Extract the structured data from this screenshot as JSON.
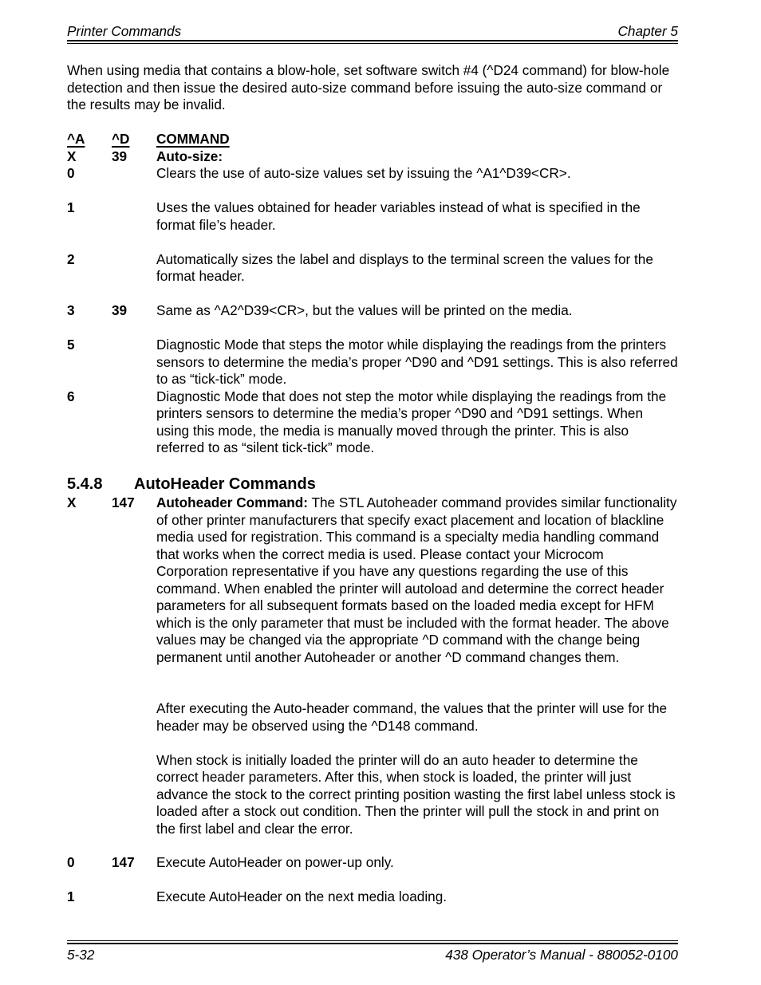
{
  "header": {
    "left": "Printer Commands",
    "right": "Chapter 5"
  },
  "intro": "When using media that contains a blow-hole, set software switch #4 (^D24 command) for blow-hole detection and then issue the desired auto-size command before issuing the auto-size command or the results may be invalid.",
  "table_header": {
    "a": "^A",
    "d": "^D",
    "command": "COMMAND"
  },
  "autosize": {
    "a": "X",
    "d": "39",
    "title": "Auto-size:",
    "rows": [
      {
        "a": "0",
        "d": "",
        "text": "Clears the use of auto-size values set by issuing the ^A1^D39<CR>."
      },
      {
        "a": "1",
        "d": "",
        "text": "Uses the values obtained for header variables instead of what is specified in the format file’s header."
      },
      {
        "a": "2",
        "d": "",
        "text": "Automatically sizes the label and displays to the terminal screen the values for the format header."
      },
      {
        "a": "3",
        "d": "39",
        "text": "Same as ^A2^D39<CR>, but the values will be printed on the media."
      },
      {
        "a": "5",
        "d": "",
        "text": "Diagnostic Mode that steps the motor while displaying the readings from the printers sensors to determine the media’s proper ^D90 and ^D91 settings. This is also referred to as “tick-tick” mode."
      },
      {
        "a": "6",
        "d": "",
        "text": "Diagnostic Mode that does not step the motor while displaying the readings from the printers sensors to determine the media’s proper ^D90 and ^D91 settings.  When using this mode, the media is manually moved through the printer.  This is also referred to as “silent tick-tick” mode."
      }
    ]
  },
  "section": {
    "number": "5.4.8",
    "title": "AutoHeader Commands"
  },
  "autoheader": {
    "a": "X",
    "d": "147",
    "lead": "Autoheader Command:",
    "paragraph1": " The STL Autoheader command provides similar functionality of other printer manufacturers that specify exact placement and location of blackline media used for registration.  This command is a specialty media handling command that works when the correct media is used.  Please contact your Microcom Corporation representative if you have any questions regarding the use of this command.  When enabled the printer will autoload and determine the correct header parameters for all subsequent formats based on the loaded media except for HFM which is the only parameter that must be included with the format header.   The above values may be changed via the appropriate ^D command with the change being permanent until another Autoheader or another ^D command changes them.",
    "paragraph2": "After executing the Auto-header command, the values that the printer will use for the header may be observed using the ^D148 command.",
    "paragraph3": "When stock is initially loaded the printer will do an auto header to determine the correct header parameters. After this, when stock is loaded, the printer will just advance the stock to the correct printing position wasting the first label unless stock is loaded after a stock out condition. Then the printer will pull the stock in and print on the first label and clear the error.",
    "rows": [
      {
        "a": "0",
        "d": "147",
        "text": "Execute AutoHeader on power-up only."
      },
      {
        "a": "1",
        "d": "",
        "text": "Execute AutoHeader on the next media loading."
      }
    ]
  },
  "footer": {
    "left": "5-32",
    "right": "438 Operator’s Manual - 880052-0100"
  }
}
